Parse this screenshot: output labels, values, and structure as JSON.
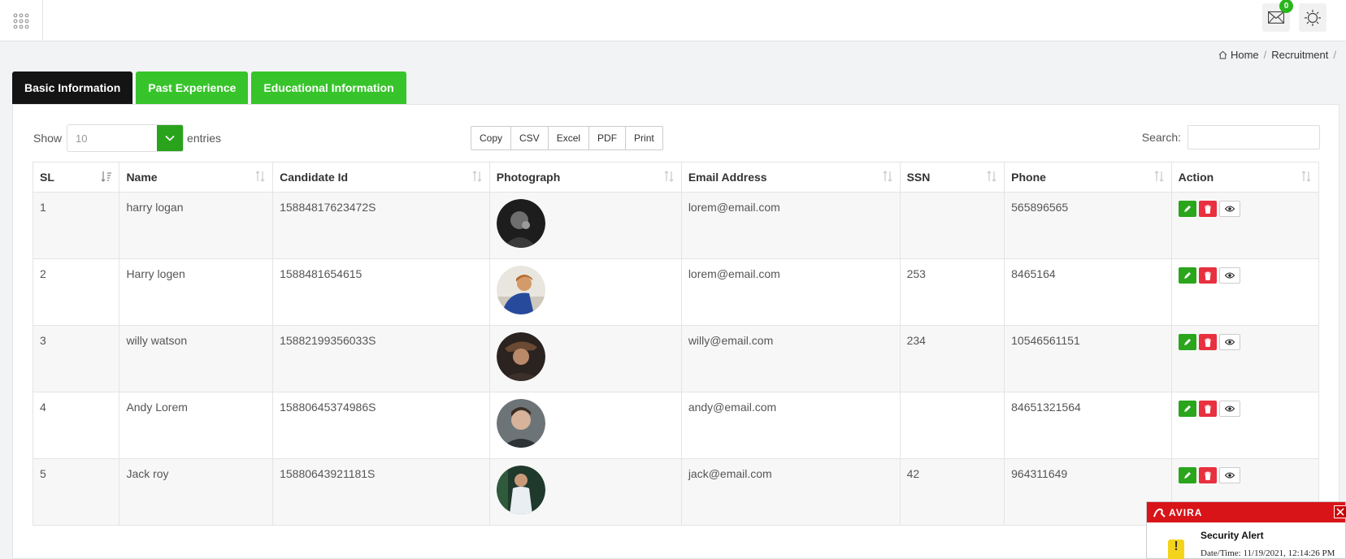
{
  "header": {
    "mail_badge": "0",
    "icons": [
      "apps-grid-icon",
      "mail-icon",
      "settings-icon"
    ]
  },
  "breadcrumb": {
    "home": "Home",
    "current": "Recruitment",
    "separator": "/"
  },
  "tabs": [
    {
      "label": "Basic Information",
      "active": true
    },
    {
      "label": "Past Experience",
      "active": false
    },
    {
      "label": "Educational Information",
      "active": false
    }
  ],
  "controls": {
    "show_label": "Show",
    "entries_value": "10",
    "entries_label": "entries",
    "export_buttons": [
      "Copy",
      "CSV",
      "Excel",
      "PDF",
      "Print"
    ],
    "search_label": "Search:",
    "search_value": ""
  },
  "table": {
    "columns": [
      "SL",
      "Name",
      "Candidate Id",
      "Photograph",
      "Email Address",
      "SSN",
      "Phone",
      "Action"
    ],
    "rows": [
      {
        "sl": "1",
        "name": "harry logan",
        "candidate_id": "15884817623472S",
        "email": "lorem@email.com",
        "ssn": "",
        "phone": "565896565"
      },
      {
        "sl": "2",
        "name": "Harry logen",
        "candidate_id": "1588481654615",
        "email": "lorem@email.com",
        "ssn": "253",
        "phone": "8465164"
      },
      {
        "sl": "3",
        "name": "willy watson",
        "candidate_id": "15882199356033S",
        "email": "willy@email.com",
        "ssn": "234",
        "phone": "10546561151"
      },
      {
        "sl": "4",
        "name": "Andy Lorem",
        "candidate_id": "15880645374986S",
        "email": "andy@email.com",
        "ssn": "",
        "phone": "84651321564"
      },
      {
        "sl": "5",
        "name": "Jack roy",
        "candidate_id": "15880643921181S",
        "email": "jack@email.com",
        "ssn": "42",
        "phone": "964311649"
      }
    ]
  },
  "avira": {
    "brand": "AVIRA",
    "title": "Security Alert",
    "datetime": "Date/Time: 11/19/2021, 12:14:26 PM"
  },
  "colors": {
    "tab_green": "#37c42b",
    "tab_active": "#141414",
    "edit": "#2aa51c",
    "delete": "#e8303e",
    "avira_red": "#d81418"
  }
}
